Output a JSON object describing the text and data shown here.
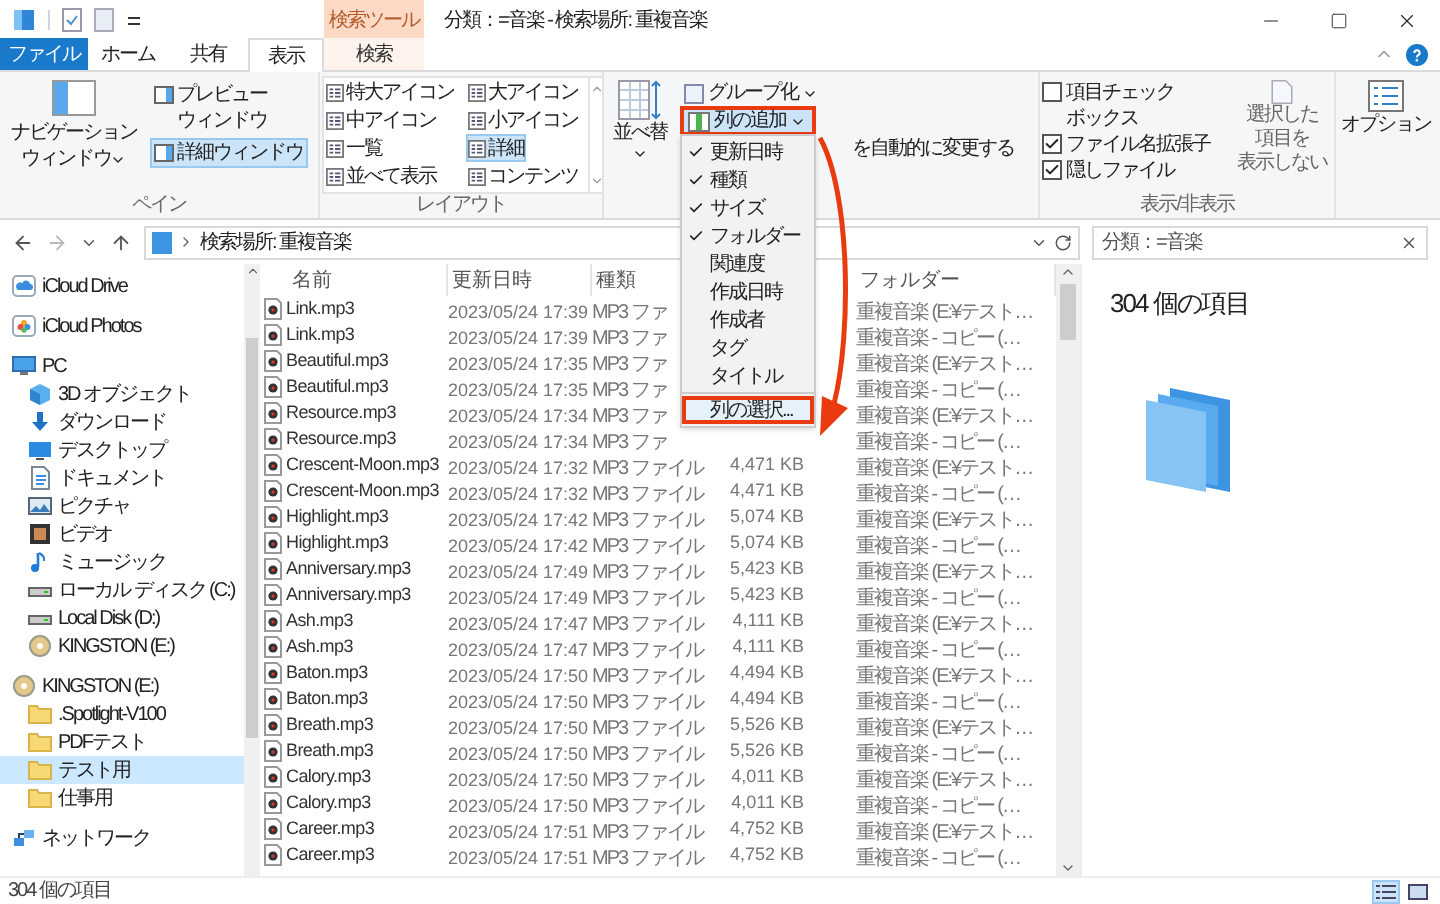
{
  "window": {
    "title": "分類：=音楽 - 検索場所: 重複音楽",
    "contextual_group": "検索ツール"
  },
  "ribbon_tabs": [
    {
      "label": "ファイル",
      "kind": "file",
      "selected": false
    },
    {
      "label": "ホーム",
      "kind": "tab",
      "selected": false
    },
    {
      "label": "共有",
      "kind": "tab",
      "selected": false
    },
    {
      "label": "表示",
      "kind": "tab",
      "selected": true
    },
    {
      "label": "検索",
      "kind": "contextual",
      "selected": false
    }
  ],
  "ribbon": {
    "pane": {
      "label": "ペイン",
      "navigation": [
        "ナビゲーション",
        "ウィンドウ"
      ],
      "toggles": [
        {
          "lines": [
            "プレビュー",
            "ウィンドウ"
          ],
          "selected": false
        },
        {
          "lines": [
            "詳細ウィンドウ"
          ],
          "selected": true
        }
      ]
    },
    "layout": {
      "label": "レイアウト",
      "options": [
        {
          "label": "特大アイコン",
          "selected": false
        },
        {
          "label": "大アイコン",
          "selected": false
        },
        {
          "label": "中アイコン",
          "selected": false
        },
        {
          "label": "小アイコン",
          "selected": false
        },
        {
          "label": "一覧",
          "selected": false
        },
        {
          "label": "詳細",
          "selected": true
        },
        {
          "label": "並べて表示",
          "selected": false
        },
        {
          "label": "コンテンツ",
          "selected": false
        }
      ]
    },
    "current_view": {
      "sort": "並べ替",
      "group": "グループ化",
      "add_columns": "列の追加",
      "autosize": "を自動的に変更する"
    },
    "show_hide": {
      "label": "表示/非表示",
      "checkboxes": [
        {
          "lines": [
            "項目チェック",
            "ボックス"
          ],
          "checked": false
        },
        {
          "lines": [
            "ファイル名拡張子"
          ],
          "checked": true
        },
        {
          "lines": [
            "隠しファイル"
          ],
          "checked": true
        }
      ],
      "hide_selected": [
        "選択した",
        "項目を",
        "表示しない"
      ]
    },
    "options": "オプション"
  },
  "address_bar": {
    "path": "検索場所: 重複音楽",
    "search": "分類：=音楽"
  },
  "navigation_pane": {
    "items": [
      {
        "label": "iCloud Drive",
        "kind": "cloud",
        "selected": false
      },
      {
        "label": "iCloud Photos",
        "kind": "photos",
        "selected": false
      },
      {
        "label": "PC",
        "kind": "pc",
        "selected": false,
        "children": [
          {
            "label": "3D オブジェクト",
            "kind": "cube",
            "selected": false
          },
          {
            "label": "ダウンロード",
            "kind": "download",
            "selected": false
          },
          {
            "label": "デスクトップ",
            "kind": "desktop",
            "selected": false
          },
          {
            "label": "ドキュメント",
            "kind": "document",
            "selected": false
          },
          {
            "label": "ピクチャ",
            "kind": "picture",
            "selected": false
          },
          {
            "label": "ビデオ",
            "kind": "video",
            "selected": false
          },
          {
            "label": "ミュージック",
            "kind": "music",
            "selected": false
          },
          {
            "label": "ローカル ディスク (C:)",
            "kind": "drive",
            "selected": false
          },
          {
            "label": "Local Disk (D:)",
            "kind": "drive",
            "selected": false
          },
          {
            "label": "KINGSTON (E:)",
            "kind": "usb",
            "selected": false
          }
        ]
      },
      {
        "label": "KINGSTON (E:)",
        "kind": "usb",
        "selected": false,
        "children": [
          {
            "label": ".Spotlight-V100",
            "kind": "folder",
            "selected": false
          },
          {
            "label": "PDFテスト",
            "kind": "folder",
            "selected": false
          },
          {
            "label": "テスト用",
            "kind": "folder",
            "selected": true
          },
          {
            "label": "仕事用",
            "kind": "folder",
            "selected": false
          }
        ]
      },
      {
        "label": "ネットワーク",
        "kind": "network",
        "selected": false
      }
    ]
  },
  "file_list": {
    "columns": [
      {
        "label": "名前",
        "kind": "name"
      },
      {
        "label": "更新日時",
        "kind": "modified"
      },
      {
        "label": "種類",
        "kind": "type"
      },
      {
        "label": "フォルダー",
        "kind": "folder"
      }
    ],
    "rows": [
      {
        "name": "Link.mp3",
        "modified": "2023/05/24 17:39",
        "type": "MP3 ファ",
        "folder": "重複音楽 (E:¥テスト…"
      },
      {
        "name": "Link.mp3",
        "modified": "2023/05/24 17:39",
        "type": "MP3 ファ",
        "folder": "重複音楽 - コピー (…"
      },
      {
        "name": "Beautiful.mp3",
        "modified": "2023/05/24 17:35",
        "type": "MP3 ファ",
        "folder": "重複音楽 (E:¥テスト…"
      },
      {
        "name": "Beautiful.mp3",
        "modified": "2023/05/24 17:35",
        "type": "MP3 ファ",
        "folder": "重複音楽 - コピー (…"
      },
      {
        "name": "Resource.mp3",
        "modified": "2023/05/24 17:34",
        "type": "MP3 ファ",
        "folder": "重複音楽 (E:¥テスト…"
      },
      {
        "name": "Resource.mp3",
        "modified": "2023/05/24 17:34",
        "type": "MP3 ファ",
        "folder": "重複音楽 - コピー (…"
      },
      {
        "name": "Crescent-Moon.mp3",
        "modified": "2023/05/24 17:32",
        "type": "MP3 ファイル",
        "size": "4,471 KB",
        "folder": "重複音楽 (E:¥テスト…"
      },
      {
        "name": "Crescent-Moon.mp3",
        "modified": "2023/05/24 17:32",
        "type": "MP3 ファイル",
        "size": "4,471 KB",
        "folder": "重複音楽 - コピー (…"
      },
      {
        "name": "Highlight.mp3",
        "modified": "2023/05/24 17:42",
        "type": "MP3 ファイル",
        "size": "5,074 KB",
        "folder": "重複音楽 (E:¥テスト…"
      },
      {
        "name": "Highlight.mp3",
        "modified": "2023/05/24 17:42",
        "type": "MP3 ファイル",
        "size": "5,074 KB",
        "folder": "重複音楽 - コピー (…"
      },
      {
        "name": "Anniversary.mp3",
        "modified": "2023/05/24 17:49",
        "type": "MP3 ファイル",
        "size": "5,423 KB",
        "folder": "重複音楽 (E:¥テスト…"
      },
      {
        "name": "Anniversary.mp3",
        "modified": "2023/05/24 17:49",
        "type": "MP3 ファイル",
        "size": "5,423 KB",
        "folder": "重複音楽 - コピー (…"
      },
      {
        "name": "Ash.mp3",
        "modified": "2023/05/24 17:47",
        "type": "MP3 ファイル",
        "size": "4,111 KB",
        "folder": "重複音楽 (E:¥テスト…"
      },
      {
        "name": "Ash.mp3",
        "modified": "2023/05/24 17:47",
        "type": "MP3 ファイル",
        "size": "4,111 KB",
        "folder": "重複音楽 - コピー (…"
      },
      {
        "name": "Baton.mp3",
        "modified": "2023/05/24 17:50",
        "type": "MP3 ファイル",
        "size": "4,494 KB",
        "folder": "重複音楽 (E:¥テスト…"
      },
      {
        "name": "Baton.mp3",
        "modified": "2023/05/24 17:50",
        "type": "MP3 ファイル",
        "size": "4,494 KB",
        "folder": "重複音楽 - コピー (…"
      },
      {
        "name": "Breath.mp3",
        "modified": "2023/05/24 17:50",
        "type": "MP3 ファイル",
        "size": "5,526 KB",
        "folder": "重複音楽 (E:¥テスト…"
      },
      {
        "name": "Breath.mp3",
        "modified": "2023/05/24 17:50",
        "type": "MP3 ファイル",
        "size": "5,526 KB",
        "folder": "重複音楽 - コピー (…"
      },
      {
        "name": "Calory.mp3",
        "modified": "2023/05/24 17:50",
        "type": "MP3 ファイル",
        "size": "4,011 KB",
        "folder": "重複音楽 (E:¥テスト…"
      },
      {
        "name": "Calory.mp3",
        "modified": "2023/05/24 17:50",
        "type": "MP3 ファイル",
        "size": "4,011 KB",
        "folder": "重複音楽 - コピー (…"
      },
      {
        "name": "Career.mp3",
        "modified": "2023/05/24 17:51",
        "type": "MP3 ファイル",
        "size": "4,752 KB",
        "folder": "重複音楽 (E:¥テスト…"
      },
      {
        "name": "Career.mp3",
        "modified": "2023/05/24 17:51",
        "type": "MP3 ファイル",
        "size": "4,752 KB",
        "folder": "重複音楽 - コピー (…"
      }
    ]
  },
  "column_menu": {
    "items": [
      {
        "label": "更新日時",
        "checked": true
      },
      {
        "label": "種類",
        "checked": true
      },
      {
        "label": "サイズ",
        "checked": true
      },
      {
        "label": "フォルダー",
        "checked": true
      },
      {
        "label": "関連度",
        "checked": false
      },
      {
        "label": "作成日時",
        "checked": false
      },
      {
        "label": "作成者",
        "checked": false
      },
      {
        "label": "タグ",
        "checked": false
      },
      {
        "label": "タイトル",
        "checked": false
      }
    ],
    "choose_columns": "列の選択..."
  },
  "details_pane": {
    "item_count": "304 個の項目"
  },
  "status_bar": {
    "item_count": "304 個の項目",
    "views": [
      {
        "kind": "details",
        "selected": true
      },
      {
        "kind": "large_icons",
        "selected": false
      }
    ]
  }
}
